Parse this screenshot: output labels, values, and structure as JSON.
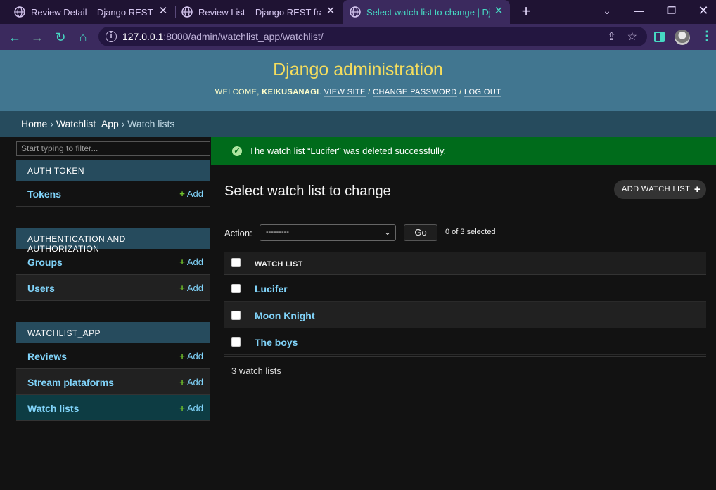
{
  "browser": {
    "tabs": [
      {
        "title": "Review Detail – Django REST framework"
      },
      {
        "title": "Review List – Django REST framework"
      },
      {
        "title": "Select watch list to change | Django site admin"
      }
    ],
    "url_host": "127.0.0.1",
    "url_path": ":8000/admin/watchlist_app/watchlist/"
  },
  "header": {
    "title": "Django administration",
    "welcome": "Welcome,",
    "username": "keikusanagi",
    "view_site": "View site",
    "change_password": "Change password",
    "log_out": "Log out"
  },
  "breadcrumbs": {
    "home": "Home",
    "app": "Watchlist_App",
    "current": "Watch lists"
  },
  "sidebar": {
    "filter_placeholder": "Start typing to filter...",
    "add_label": "Add",
    "modules": [
      {
        "caption": "Auth Token",
        "items": [
          "Tokens"
        ]
      },
      {
        "caption": "Authentication and Authorization",
        "items": [
          "Groups",
          "Users"
        ]
      },
      {
        "caption": "Watchlist_App",
        "items": [
          "Reviews",
          "Stream plataforms",
          "Watch lists"
        ]
      }
    ]
  },
  "message": "The watch list “Lucifer” was deleted successfully.",
  "content": {
    "title": "Select watch list to change",
    "add_button": "Add watch list",
    "action_label": "Action:",
    "action_selected": "---------",
    "go_button": "Go",
    "selected_count": "0 of 3 selected",
    "column_header": "Watch list",
    "rows": [
      "Lucifer",
      "Moon Knight",
      "The boys"
    ],
    "paginator": "3 watch lists"
  },
  "colors": {
    "header_bg": "#417690",
    "breadcrumbs_bg": "#264b5d",
    "success_bg": "#006b1b",
    "link": "#81d4fa",
    "title_yellow": "#f5dd5d",
    "add_green": "#70bf2b"
  }
}
